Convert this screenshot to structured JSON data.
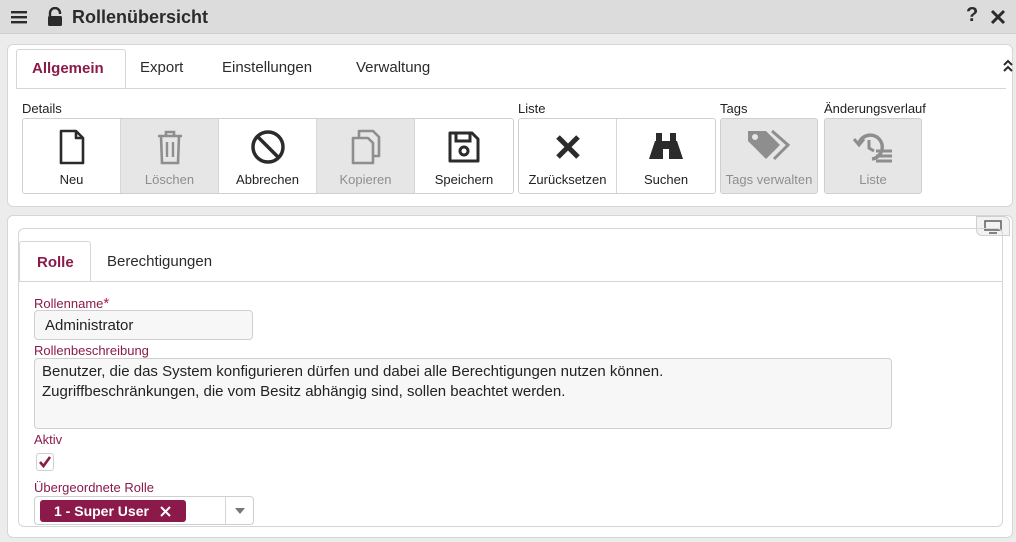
{
  "window": {
    "title": "Rollenübersicht",
    "help": "?"
  },
  "top_tabs": [
    "Allgemein",
    "Export",
    "Einstellungen",
    "Verwaltung"
  ],
  "toolbar": {
    "groups": {
      "details": "Details",
      "liste": "Liste",
      "tags": "Tags",
      "history": "Änderungsverlauf"
    },
    "buttons": {
      "neu": "Neu",
      "loeschen": "Löschen",
      "abbrechen": "Abbrechen",
      "kopieren": "Kopieren",
      "speichern": "Speichern",
      "zuruecksetzen": "Zurücksetzen",
      "suchen": "Suchen",
      "tags_verwalten": "Tags verwalten",
      "liste": "Liste"
    },
    "disabled": [
      "Löschen",
      "Kopieren",
      "Tags verwalten",
      "Liste"
    ]
  },
  "sub_tabs": [
    "Rolle",
    "Berechtigungen"
  ],
  "form": {
    "rollenname_label": "Rollenname",
    "required_mark": "*",
    "rollenname_value": "Administrator",
    "beschreibung_label": "Rollenbeschreibung",
    "beschreibung_value": "Benutzer, die das System konfigurieren dürfen und dabei alle Berechtigungen nutzen können.\nZugriffbeschränkungen, die vom Besitz abhängig sind, sollen beachtet werden.",
    "aktiv_label": "Aktiv",
    "aktiv_checked": true,
    "parent_label": "Übergeordnete Rolle",
    "parent_chip": "1 - Super User"
  },
  "colors": {
    "accent": "#8b1a4a",
    "titlebar": "#dcdcdc",
    "disabled": "#e6e6e6"
  }
}
